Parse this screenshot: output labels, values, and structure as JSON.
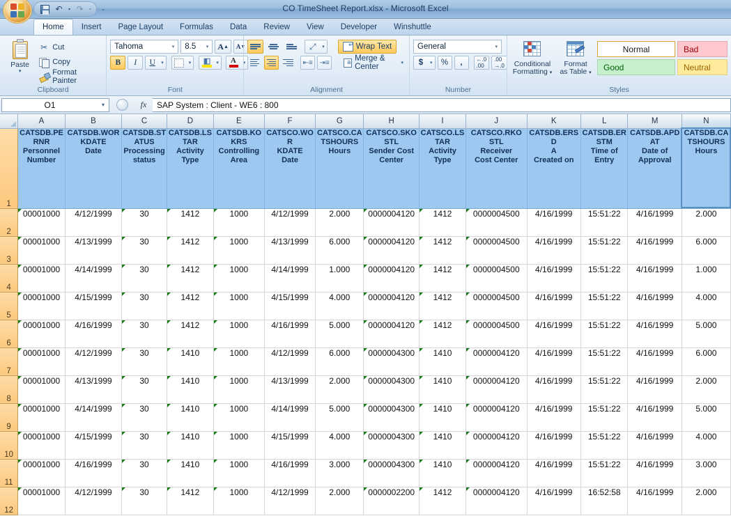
{
  "window": {
    "title": "CO TimeSheet Report.xlsx - Microsoft Excel"
  },
  "quick_access": {
    "save": "Save",
    "undo": "Undo",
    "redo": "Redo",
    "customize": "Customize Quick Access Toolbar"
  },
  "tabs": [
    {
      "label": "Home",
      "active": true
    },
    {
      "label": "Insert",
      "active": false
    },
    {
      "label": "Page Layout",
      "active": false
    },
    {
      "label": "Formulas",
      "active": false
    },
    {
      "label": "Data",
      "active": false
    },
    {
      "label": "Review",
      "active": false
    },
    {
      "label": "View",
      "active": false
    },
    {
      "label": "Developer",
      "active": false
    },
    {
      "label": "Winshuttle",
      "active": false
    }
  ],
  "ribbon": {
    "clipboard": {
      "title": "Clipboard",
      "paste": "Paste",
      "cut": "Cut",
      "copy": "Copy",
      "format_painter": "Format Painter"
    },
    "font": {
      "title": "Font",
      "font_name": "Tahoma",
      "font_size": "8.5",
      "grow": "A",
      "shrink": "A",
      "bold": "B",
      "italic": "I",
      "underline": "U",
      "borders": "Borders",
      "fill_color": "A",
      "font_color": "A"
    },
    "alignment": {
      "title": "Alignment",
      "wrap_text": "Wrap Text",
      "merge_center": "Merge & Center"
    },
    "number": {
      "title": "Number",
      "format": "General",
      "currency": "$",
      "percent": "%",
      "comma": ",",
      "increase_decimal": ".00",
      "decrease_decimal": ".00"
    },
    "styles": {
      "title": "Styles",
      "conditional_formatting": "Conditional\nFormatting",
      "conditional_formatting_l1": "Conditional",
      "conditional_formatting_l2": "Formatting",
      "format_as_table_l1": "Format",
      "format_as_table_l2": "as Table",
      "cells": [
        {
          "label": "Normal",
          "key": "normal"
        },
        {
          "label": "Bad",
          "key": "bad"
        },
        {
          "label": "Good",
          "key": "good"
        },
        {
          "label": "Neutral",
          "key": "neutral"
        }
      ]
    }
  },
  "formula_bar": {
    "name_box": "O1",
    "formula": "SAP System : Client - WE6 : 800"
  },
  "sheet": {
    "column_letters": [
      "A",
      "B",
      "C",
      "D",
      "E",
      "F",
      "G",
      "H",
      "I",
      "J",
      "K",
      "L",
      "M",
      "N"
    ],
    "selected_column": "N",
    "headers": [
      "CATSDB.PERNR\nPersonnel Number",
      "CATSDB.WORKDATE\nDate",
      "CATSDB.STATUS\nProcessing status",
      "CATSDB.LSTAR\nActivity Type",
      "CATSDB.KOKRS\nControlling Area",
      "CATSCO.WORKDATE\nDate",
      "CATSCO.CATSHOURS\nHours",
      "CATSCO.SKOSTL\nSender Cost Center",
      "CATSCO.LSTAR\nActivity Type",
      "CATSCO.RKOSTL\nReceiver Cost Center",
      "CATSDB.ERSDA\nCreated on",
      "CATSDB.ERSTM\nTime of Entry",
      "CATSDB.APDAT\nDate of Approval",
      "CATSDB.CATSHOURS\nHours"
    ],
    "header_lines": [
      [
        "CATSDB.PE",
        "RNR",
        "Personnel",
        "Number"
      ],
      [
        "CATSDB.WOR",
        "KDATE",
        "Date"
      ],
      [
        "CATSDB.ST",
        "ATUS",
        "Processing",
        "status"
      ],
      [
        "CATSDB.LS",
        "TAR",
        "Activity",
        "Type"
      ],
      [
        "CATSDB.KO",
        "KRS",
        "Controlling",
        "Area"
      ],
      [
        "CATSCO.WOR",
        "KDATE",
        "Date"
      ],
      [
        "CATSCO.CA",
        "TSHOURS",
        "Hours"
      ],
      [
        "CATSCO.SKO",
        "STL",
        "Sender Cost",
        "Center"
      ],
      [
        "CATSCO.LS",
        "TAR",
        "Activity",
        "Type"
      ],
      [
        "CATSCO.RKO",
        "STL",
        "Receiver",
        "Cost Center"
      ],
      [
        "CATSDB.ERSD",
        "A",
        "Created on"
      ],
      [
        "CATSDB.ER",
        "STM",
        "Time of",
        "Entry"
      ],
      [
        "CATSDB.APD",
        "AT",
        "Date of",
        "Approval"
      ],
      [
        "CATSDB.CA",
        "TSHOURS",
        "Hours"
      ]
    ],
    "row_numbers": [
      "1",
      "2",
      "3",
      "4",
      "5",
      "6",
      "7",
      "8",
      "9",
      "10",
      "11",
      "12"
    ],
    "rows": [
      {
        "n": "2",
        "cells": [
          "00001000",
          "4/12/1999",
          "30",
          "1412",
          "1000",
          "4/12/1999",
          "2.000",
          "0000004120",
          "1412",
          "0000004500",
          "4/16/1999",
          "15:51:22",
          "4/16/1999",
          "2.000"
        ]
      },
      {
        "n": "3",
        "cells": [
          "00001000",
          "4/13/1999",
          "30",
          "1412",
          "1000",
          "4/13/1999",
          "6.000",
          "0000004120",
          "1412",
          "0000004500",
          "4/16/1999",
          "15:51:22",
          "4/16/1999",
          "6.000"
        ]
      },
      {
        "n": "4",
        "cells": [
          "00001000",
          "4/14/1999",
          "30",
          "1412",
          "1000",
          "4/14/1999",
          "1.000",
          "0000004120",
          "1412",
          "0000004500",
          "4/16/1999",
          "15:51:22",
          "4/16/1999",
          "1.000"
        ]
      },
      {
        "n": "5",
        "cells": [
          "00001000",
          "4/15/1999",
          "30",
          "1412",
          "1000",
          "4/15/1999",
          "4.000",
          "0000004120",
          "1412",
          "0000004500",
          "4/16/1999",
          "15:51:22",
          "4/16/1999",
          "4.000"
        ]
      },
      {
        "n": "6",
        "cells": [
          "00001000",
          "4/16/1999",
          "30",
          "1412",
          "1000",
          "4/16/1999",
          "5.000",
          "0000004120",
          "1412",
          "0000004500",
          "4/16/1999",
          "15:51:22",
          "4/16/1999",
          "5.000"
        ]
      },
      {
        "n": "7",
        "cells": [
          "00001000",
          "4/12/1999",
          "30",
          "1410",
          "1000",
          "4/12/1999",
          "6.000",
          "0000004300",
          "1410",
          "0000004120",
          "4/16/1999",
          "15:51:22",
          "4/16/1999",
          "6.000"
        ]
      },
      {
        "n": "8",
        "cells": [
          "00001000",
          "4/13/1999",
          "30",
          "1410",
          "1000",
          "4/13/1999",
          "2.000",
          "0000004300",
          "1410",
          "0000004120",
          "4/16/1999",
          "15:51:22",
          "4/16/1999",
          "2.000"
        ]
      },
      {
        "n": "9",
        "cells": [
          "00001000",
          "4/14/1999",
          "30",
          "1410",
          "1000",
          "4/14/1999",
          "5.000",
          "0000004300",
          "1410",
          "0000004120",
          "4/16/1999",
          "15:51:22",
          "4/16/1999",
          "5.000"
        ]
      },
      {
        "n": "10",
        "cells": [
          "00001000",
          "4/15/1999",
          "30",
          "1410",
          "1000",
          "4/15/1999",
          "4.000",
          "0000004300",
          "1410",
          "0000004120",
          "4/16/1999",
          "15:51:22",
          "4/16/1999",
          "4.000"
        ]
      },
      {
        "n": "11",
        "cells": [
          "00001000",
          "4/16/1999",
          "30",
          "1410",
          "1000",
          "4/16/1999",
          "3.000",
          "0000004300",
          "1410",
          "0000004120",
          "4/16/1999",
          "15:51:22",
          "4/16/1999",
          "3.000"
        ]
      },
      {
        "n": "12",
        "cells": [
          "00001000",
          "4/12/1999",
          "30",
          "1412",
          "1000",
          "4/12/1999",
          "2.000",
          "0000002200",
          "1412",
          "0000004120",
          "4/16/1999",
          "16:52:58",
          "4/16/1999",
          "2.000"
        ]
      }
    ],
    "error_flag_columns": [
      0,
      2,
      3,
      4,
      7,
      8,
      9
    ],
    "colors": {
      "header_fill": "#9dc9f0",
      "header_text": "#123055",
      "row_header_fill": "#fcc97e",
      "error_triangle": "#1a7a1a"
    }
  }
}
